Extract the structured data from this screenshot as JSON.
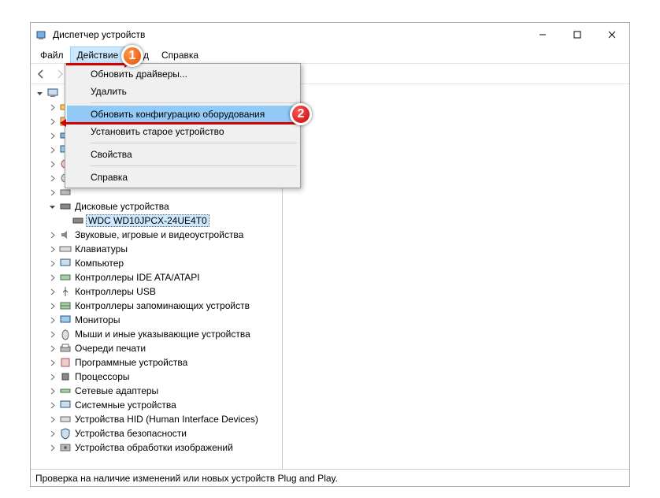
{
  "window": {
    "title": "Диспетчер устройств"
  },
  "menu": {
    "file": "Файл",
    "action": "Действие",
    "view": "Вид",
    "help": "Справка"
  },
  "dropdown": {
    "update_drivers": "Обновить драйверы...",
    "delete": "Удалить",
    "scan_hardware": "Обновить конфигурацию оборудования",
    "add_legacy": "Установить старое устройство",
    "properties": "Свойства",
    "help": "Справка"
  },
  "tree": {
    "root": "",
    "disk_drives": "Дисковые устройства",
    "disk_child": "WDC WD10JPCX-24UE4T0",
    "sound": "Звуковые, игровые и видеоустройства",
    "keyboards": "Клавиатуры",
    "computer": "Компьютер",
    "ide": "Контроллеры IDE ATA/ATAPI",
    "usb": "Контроллеры USB",
    "storage": "Контроллеры запоминающих устройств",
    "monitors": "Мониторы",
    "mice": "Мыши и иные указывающие устройства",
    "print_queues": "Очереди печати",
    "software": "Программные устройства",
    "processors": "Процессоры",
    "network": "Сетевые адаптеры",
    "system": "Системные устройства",
    "hid": "Устройства HID (Human Interface Devices)",
    "security": "Устройства безопасности",
    "imaging": "Устройства обработки изображений"
  },
  "status": "Проверка на наличие изменений или новых устройств Plug and Play.",
  "callouts": {
    "one": "1",
    "two": "2"
  }
}
